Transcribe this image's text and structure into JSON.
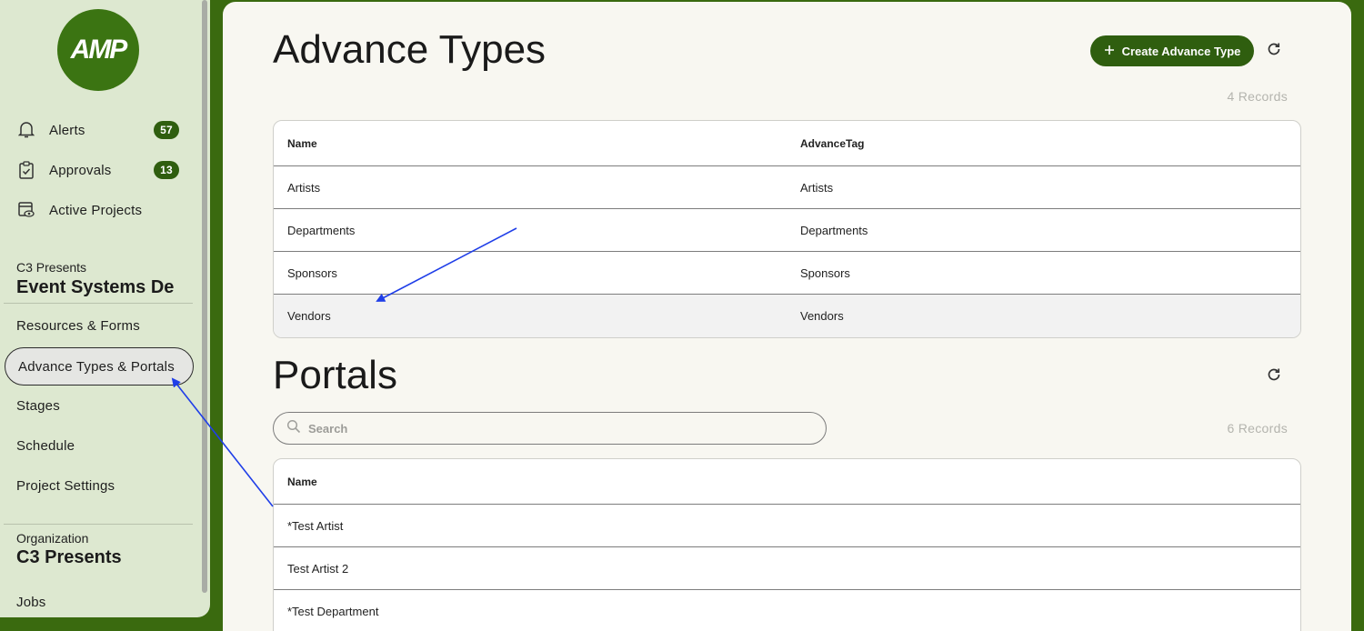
{
  "sidebar": {
    "logo_text": "AMP",
    "nav": [
      {
        "label": "Alerts",
        "badge": "57",
        "icon": "bell-icon"
      },
      {
        "label": "Approvals",
        "badge": "13",
        "icon": "clipboard-check-icon"
      },
      {
        "label": "Active Projects",
        "icon": "calendar-eye-icon"
      }
    ],
    "project": {
      "org_label": "C3 Presents",
      "name": "Event Systems De",
      "items": [
        {
          "label": "Resources & Forms"
        },
        {
          "label": "Advance Types & Portals",
          "active": true
        },
        {
          "label": "Stages"
        },
        {
          "label": "Schedule"
        },
        {
          "label": "Project Settings"
        }
      ]
    },
    "organization": {
      "label": "Organization",
      "name": "C3 Presents",
      "items": [
        {
          "label": "Jobs"
        }
      ]
    }
  },
  "advance_types": {
    "title": "Advance Types",
    "create_button": "Create Advance Type",
    "records": "4 Records",
    "columns": [
      "Name",
      "AdvanceTag"
    ],
    "rows": [
      [
        "Artists",
        "Artists"
      ],
      [
        "Departments",
        "Departments"
      ],
      [
        "Sponsors",
        "Sponsors"
      ],
      [
        "Vendors",
        "Vendors"
      ]
    ]
  },
  "portals": {
    "title": "Portals",
    "search_placeholder": "Search",
    "records": "6 Records",
    "columns": [
      "Name"
    ],
    "rows": [
      [
        "*Test Artist"
      ],
      [
        "Test Artist 2"
      ],
      [
        "*Test Department"
      ]
    ]
  },
  "colors": {
    "brand": "#2f5e0f",
    "background": "#3a6a0f",
    "sidebar": "#dde8d0",
    "annotation": "#1f3ee8"
  }
}
